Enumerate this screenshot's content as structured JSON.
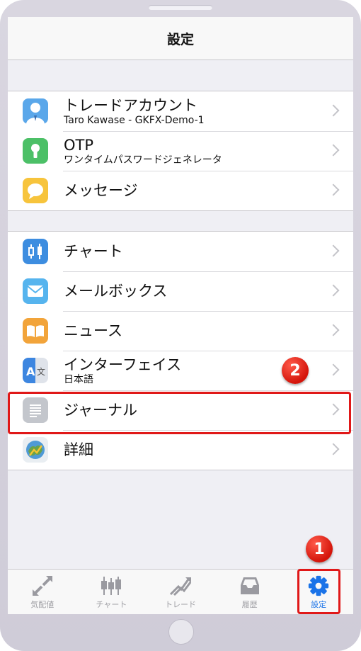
{
  "header": {
    "title": "設定"
  },
  "groups": [
    {
      "items": [
        {
          "label": "トレードアカウント",
          "sub": "Taro Kawase - GKFX-Demo-1",
          "icon": "user-icon",
          "color": "#5aa7ea"
        },
        {
          "label": "OTP",
          "sub": "ワンタイムパスワードジェネレータ",
          "icon": "keyhole-icon",
          "color": "#4cc067"
        },
        {
          "label": "メッセージ",
          "icon": "chat-bubble-icon",
          "color": "#f7c43c"
        }
      ]
    },
    {
      "items": [
        {
          "label": "チャート",
          "icon": "candlestick-icon",
          "color": "#3d8de0"
        },
        {
          "label": "メールボックス",
          "icon": "envelope-icon",
          "color": "#56b4ee"
        },
        {
          "label": "ニュース",
          "icon": "book-icon",
          "color": "#f2a43a"
        },
        {
          "label": "インターフェイス",
          "sub": "日本語",
          "icon": "translate-icon",
          "color": "#3d86e0"
        },
        {
          "label": "ジャーナル",
          "icon": "journal-icon",
          "color": "#c3c6cc"
        },
        {
          "label": "詳細",
          "icon": "metatrader-icon",
          "color": "#6aa24a"
        }
      ]
    }
  ],
  "tabs": [
    {
      "label": "気配値",
      "icon": "quotes-arrows-icon",
      "active": false
    },
    {
      "label": "チャート",
      "icon": "candlestick-icon",
      "active": false
    },
    {
      "label": "トレード",
      "icon": "trade-trend-icon",
      "active": false
    },
    {
      "label": "履歴",
      "icon": "inbox-tray-icon",
      "active": false
    },
    {
      "label": "設定",
      "icon": "gear-icon",
      "active": true
    }
  ],
  "annotations": {
    "badge_1": "1",
    "badge_2": "2"
  },
  "colors": {
    "highlight": "#e01818",
    "active_tab": "#1a73e8",
    "inactive_tab": "#a0a0a5"
  }
}
